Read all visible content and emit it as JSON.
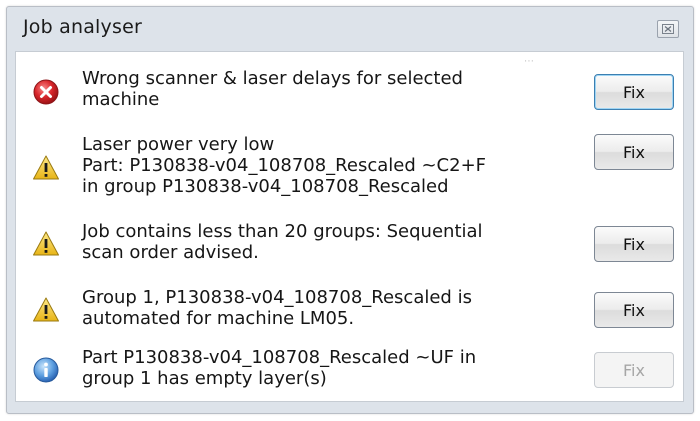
{
  "window": {
    "title": "Job analyser",
    "close_glyph": "⊠"
  },
  "messages": [
    {
      "severity": "error",
      "icon": "error-icon",
      "lines": [
        "Wrong scanner & laser delays for selected",
        "machine"
      ],
      "button_label": "Fix",
      "button_enabled": true
    },
    {
      "severity": "warning",
      "icon": "warning-icon",
      "lines": [
        "Laser power very low",
        "Part: P130838-v04_108708_Rescaled ~C2+F",
        "in group P130838-v04_108708_Rescaled"
      ],
      "button_label": "Fix",
      "button_enabled": true
    },
    {
      "severity": "warning",
      "icon": "warning-icon",
      "lines": [
        "Job contains less than 20 groups: Sequential",
        "scan order advised."
      ],
      "button_label": "Fix",
      "button_enabled": true
    },
    {
      "severity": "warning",
      "icon": "warning-icon",
      "lines": [
        "Group 1, P130838-v04_108708_Rescaled  is",
        "automated for machine LM05."
      ],
      "button_label": "Fix",
      "button_enabled": true
    },
    {
      "severity": "info",
      "icon": "info-icon",
      "lines": [
        "Part P130838-v04_108708_Rescaled ~UF in",
        "group 1 has empty layer(s)"
      ],
      "button_label": "Fix",
      "button_enabled": false
    }
  ],
  "colors": {
    "error_red": "#d9262b",
    "warning_yellow": "#f3cc2c",
    "info_blue": "#3a7fd1",
    "window_bg": "#dde3ea"
  }
}
